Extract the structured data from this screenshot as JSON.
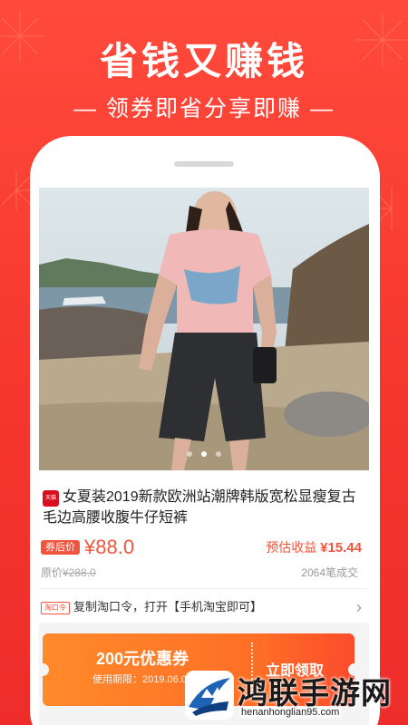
{
  "banner": {
    "headline": "省钱又赚钱",
    "subline": "— 领券即省分享即赚 —"
  },
  "product": {
    "platform_badge": "天猫",
    "title": "女夏装2019新款欧洲站潮牌韩版宽松显瘦复古毛边高腰收腹牛仔短裤",
    "price_tag": "券后价",
    "price": "¥88.0",
    "earnings_label": "预估收益",
    "earnings_value": "¥15.44",
    "original_price_label": "原价",
    "original_price": "¥288.0",
    "sold": "2064笔成交"
  },
  "copy_row": {
    "tag": "淘口令",
    "text": "复制淘口令，打开【手机淘宝即可】"
  },
  "coupon": {
    "amount": "200元优惠券",
    "validity": "使用期限：2019.06.03",
    "cta": "立即领取"
  },
  "watermark": {
    "title": "鸿联手游网",
    "url": "henanhonglian95.com"
  },
  "carousel": {
    "count": 3,
    "active": 1
  },
  "colors": {
    "brand_red": "#f5362e",
    "price": "#f1543d",
    "coupon_orange": "#ff7a28"
  },
  "icons": [
    "tmall-icon",
    "chevron-right-icon",
    "watermark-logo-icon"
  ]
}
